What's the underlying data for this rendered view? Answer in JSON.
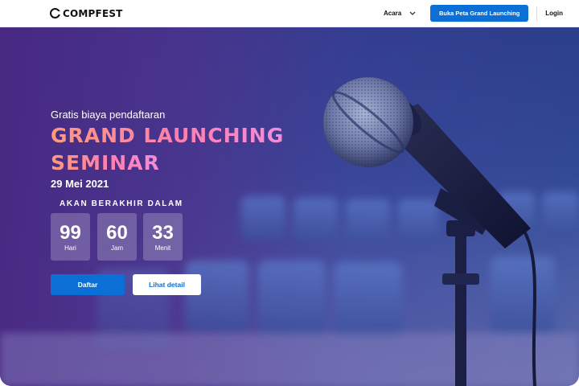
{
  "navbar": {
    "logo_text": "COMPFEST",
    "menu_acara": "Acara",
    "cta_label": "Buka Peta Grand Launching",
    "login_label": "Login"
  },
  "hero": {
    "subtitle": "Gratis biaya pendaftaran",
    "headline_line1": "GRAND LAUNCHING",
    "headline_line2": "SEMINAR",
    "date": "29 Mei 2021",
    "countdown_title": "AKAN BERAKHIR DALAM",
    "countdown": [
      {
        "value": "99",
        "unit": "Hari"
      },
      {
        "value": "60",
        "unit": "Jam"
      },
      {
        "value": "33",
        "unit": "Menit"
      }
    ],
    "primary_button": "Daftar",
    "secondary_button": "Lihat detail"
  },
  "colors": {
    "primary": "#0b6fd6",
    "headline_gradient_start": "#ff9a7a",
    "headline_gradient_end": "#f38dd8",
    "hero_overlay": "#4b2a86"
  },
  "icons": {
    "logo": "compfest-logo-icon",
    "dropdown": "chevron-down-icon",
    "background": "microphone-image"
  }
}
